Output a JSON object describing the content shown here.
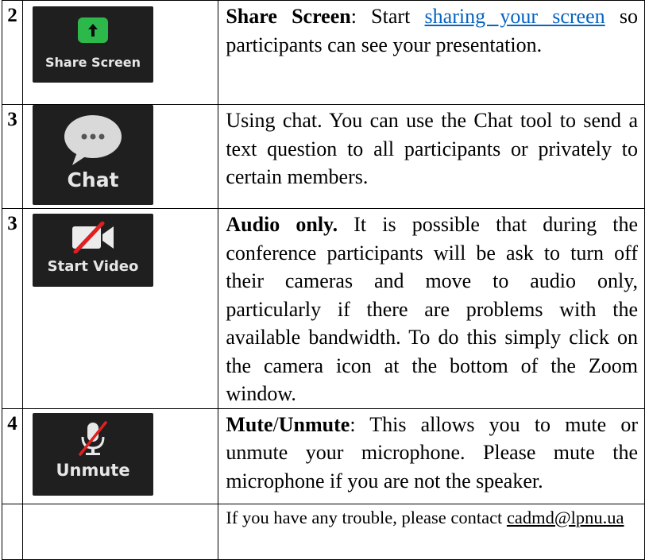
{
  "rows": [
    {
      "num": "2",
      "tile_label": "Share Screen",
      "title": "Share Screen",
      "text_before_link": ": Start ",
      "link_text": "sharing your screen",
      "text_after_link": " so participants can see your presentation."
    },
    {
      "num": "3",
      "tile_label": "Chat",
      "text": "Using chat. You can use the Chat tool to send a text question to all participants or privately to certain members."
    },
    {
      "num": "3",
      "tile_label": "Start Video",
      "title": "Audio only.",
      "text": " It is possible that during the conference participants will be ask to turn off their cameras and move to audio only, particularly if there are problems with the available bandwidth. To do this simply click on the camera icon at the bottom of the Zoom window."
    },
    {
      "num": "4",
      "tile_label": "Unmute",
      "title_a": "Mute",
      "title_sep": "/",
      "title_b": "Unmute",
      "text": ": This allows you to mute or unmute your microphone. Please mute the microphone if you are not the speaker."
    },
    {
      "num": "",
      "text": "If you have any trouble, please contact ",
      "email": "cadmd@lpnu.ua"
    }
  ],
  "colors": {
    "tile_bg": "#1f1f1f",
    "share_green": "#2db84c",
    "link_blue": "#0563c1",
    "mute_red": "#e02020"
  }
}
